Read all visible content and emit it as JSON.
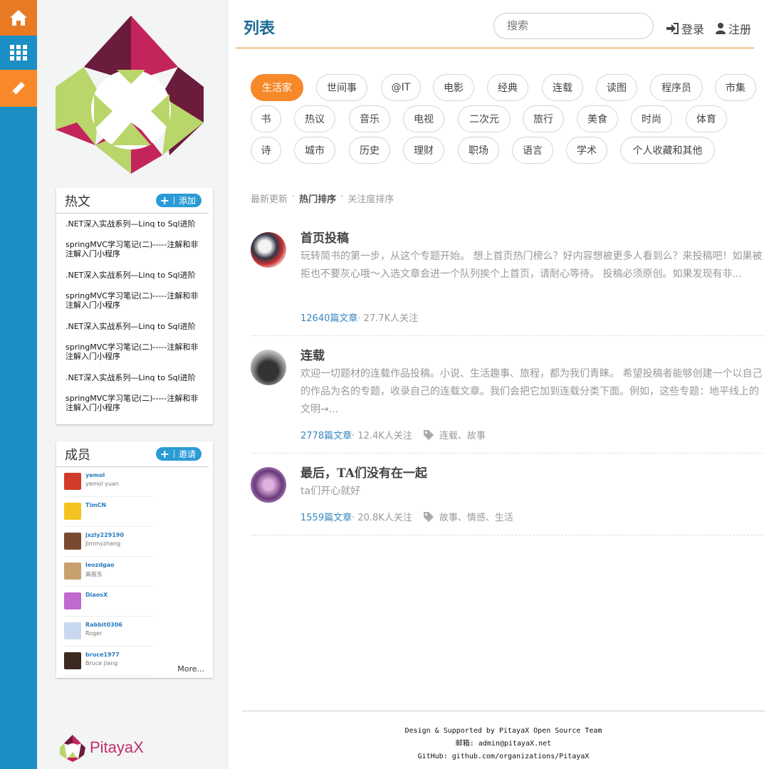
{
  "rail": {
    "home_icon": "home-icon",
    "grid_icon": "grid-icon",
    "edit_icon": "pencil-icon",
    "colors": {
      "rail": "#1b8fc5",
      "home": "#e77a23",
      "edit": "#f7892a"
    }
  },
  "hot": {
    "title": "热文",
    "add_label": "添加",
    "items": [
      ".NET深入实战系列—Linq to Sql进阶",
      "springMVC学习笔记(二)-----注解和非注解入门小程序",
      ".NET深入实战系列—Linq to Sql进阶",
      "springMVC学习笔记(二)-----注解和非注解入门小程序",
      ".NET深入实战系列—Linq to Sql进阶",
      "springMVC学习笔记(二)-----注解和非注解入门小程序",
      ".NET深入实战系列—Linq to Sql进阶",
      "springMVC学习笔记(二)-----注解和非注解入门小程序"
    ]
  },
  "members": {
    "title": "成员",
    "invite_label": "邀请",
    "more": "More...",
    "items": [
      {
        "name": "yemol",
        "sub": "yemol yuan"
      },
      {
        "name": "TimCN",
        "sub": ""
      },
      {
        "name": "jxzly229190",
        "sub": "Jimmyzhang"
      },
      {
        "name": "leozdgao",
        "sub": "高振东"
      },
      {
        "name": "DiaosX",
        "sub": ""
      },
      {
        "name": "Rabbit0306",
        "sub": "Roger"
      },
      {
        "name": "bruce1977",
        "sub": "Bruce Jiang"
      }
    ]
  },
  "brand": {
    "name": "PitayaX"
  },
  "header": {
    "title": "列表",
    "search_placeholder": "搜索",
    "login": "登录",
    "register": "注册"
  },
  "tags": [
    "生活家",
    "世间事",
    "@IT",
    "电影",
    "经典",
    "连载",
    "读图",
    "程序员",
    "市集",
    "书",
    "热议",
    "音乐",
    "电视",
    "二次元",
    "旅行",
    "美食",
    "时尚",
    "体育",
    "诗",
    "城市",
    "历史",
    "理财",
    "职场",
    "语言",
    "学术",
    "个人收藏和其他"
  ],
  "active_tag": "生活家",
  "sort": {
    "latest": "最新更新",
    "hot": "热门排序",
    "follow": "关注度排序",
    "dot": "·"
  },
  "topics": [
    {
      "title": "首页投稿",
      "desc": "玩转简书的第一步，从这个专题开始。 想上首页热门榜么？好内容想被更多人看到么？来投稿吧！如果被拒也不要灰心哦～入选文章会进一个队列挨个上首页，请耐心等待。 投稿必须原创。如果发现有非...",
      "count": "12640篇文章",
      "followers": " · 27.7K人关注",
      "tags": ""
    },
    {
      "title": "连载",
      "desc": "欢迎一切题材的连载作品投稿。小说、生活趣事、旅程，都为我们青睐。 希望投稿者能够创建一个以自己的作品为名的专题，收录自己的连载文章。我们会把它加到连载分类下面。例如，这些专题：地平线上的文明→...",
      "count": "2778篇文章",
      "followers": " · 12.4K人关注",
      "tags": "连载、故事"
    },
    {
      "title": "最后，TA们没有在一起",
      "desc": "ta们开心就好",
      "count": "1559篇文章",
      "followers": " · 20.8K人关注",
      "tags": "故事、情感、生活"
    }
  ],
  "footer": {
    "line1": "Design & Supported by PitayaX Open Source Team",
    "line2": "邮箱: admin@pitayaX.net",
    "line3": "GitHub: github.com/organizations/PitayaX"
  }
}
